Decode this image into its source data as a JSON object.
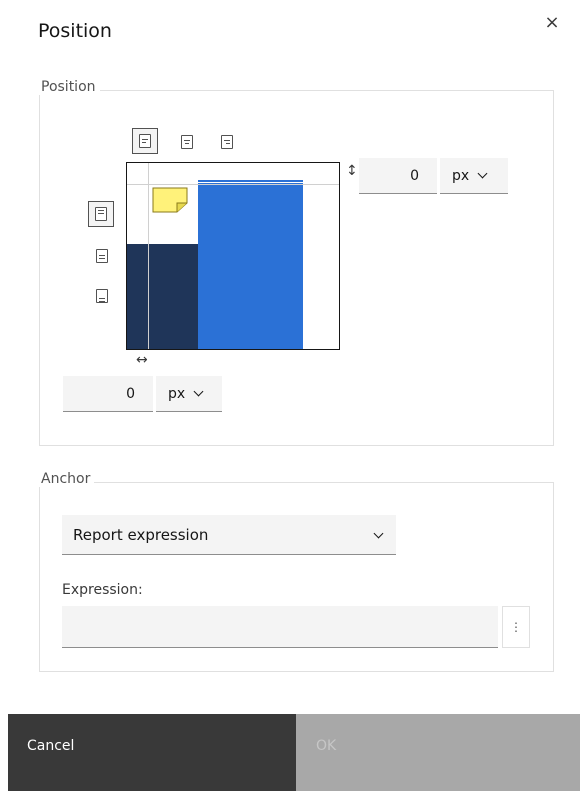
{
  "dialog": {
    "title": "Position",
    "close_glyph": "×"
  },
  "position": {
    "legend": "Position",
    "vertical_offset": {
      "value": "0",
      "unit": "px"
    },
    "horizontal_offset": {
      "value": "0",
      "unit": "px"
    },
    "vertical_arrow": "↕",
    "horizontal_arrow": "↔",
    "horizontal_alignment_icons": [
      "align-left-icon",
      "align-center-icon",
      "align-right-icon"
    ],
    "vertical_alignment_icons": [
      "align-top-icon",
      "align-middle-icon",
      "align-bottom-icon"
    ],
    "selected_horizontal": "align-left-icon",
    "selected_vertical": "align-top-icon"
  },
  "anchor": {
    "legend": "Anchor",
    "selected_option": "Report expression",
    "expression_label": "Expression:",
    "expression_value": "",
    "menu_glyph": "⋮"
  },
  "footer": {
    "cancel_label": "Cancel",
    "ok_label": "OK"
  },
  "colors": {
    "preview_dark": "#1f3559",
    "preview_blue": "#2b71d6",
    "note_yellow": "#fff27a",
    "cancel_bg": "#393939",
    "ok_disabled_bg": "#a8a8a8"
  }
}
